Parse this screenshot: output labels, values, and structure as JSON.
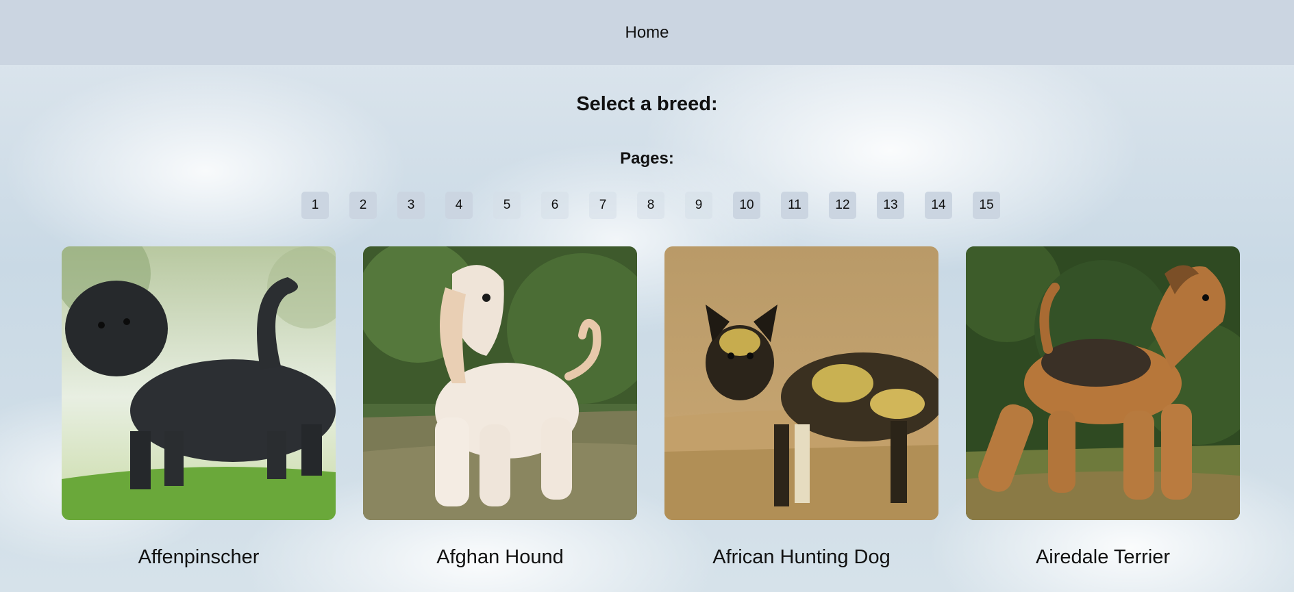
{
  "nav": {
    "home_label": "Home"
  },
  "heading": "Select a breed:",
  "pages_label": "Pages:",
  "pages": [
    "1",
    "2",
    "3",
    "4",
    "5",
    "6",
    "7",
    "8",
    "9",
    "10",
    "11",
    "12",
    "13",
    "14",
    "15"
  ],
  "breeds": [
    {
      "name": "Affenpinscher",
      "icon": "affenpinscher-photo"
    },
    {
      "name": "Afghan Hound",
      "icon": "afghan-hound-photo"
    },
    {
      "name": "African Hunting Dog",
      "icon": "african-hunting-dog-photo"
    },
    {
      "name": "Airedale Terrier",
      "icon": "airedale-terrier-photo"
    }
  ],
  "colors": {
    "nav_bg": "#cbd5e1",
    "page_button_bg": "#cbd5e1",
    "text": "#111111"
  }
}
